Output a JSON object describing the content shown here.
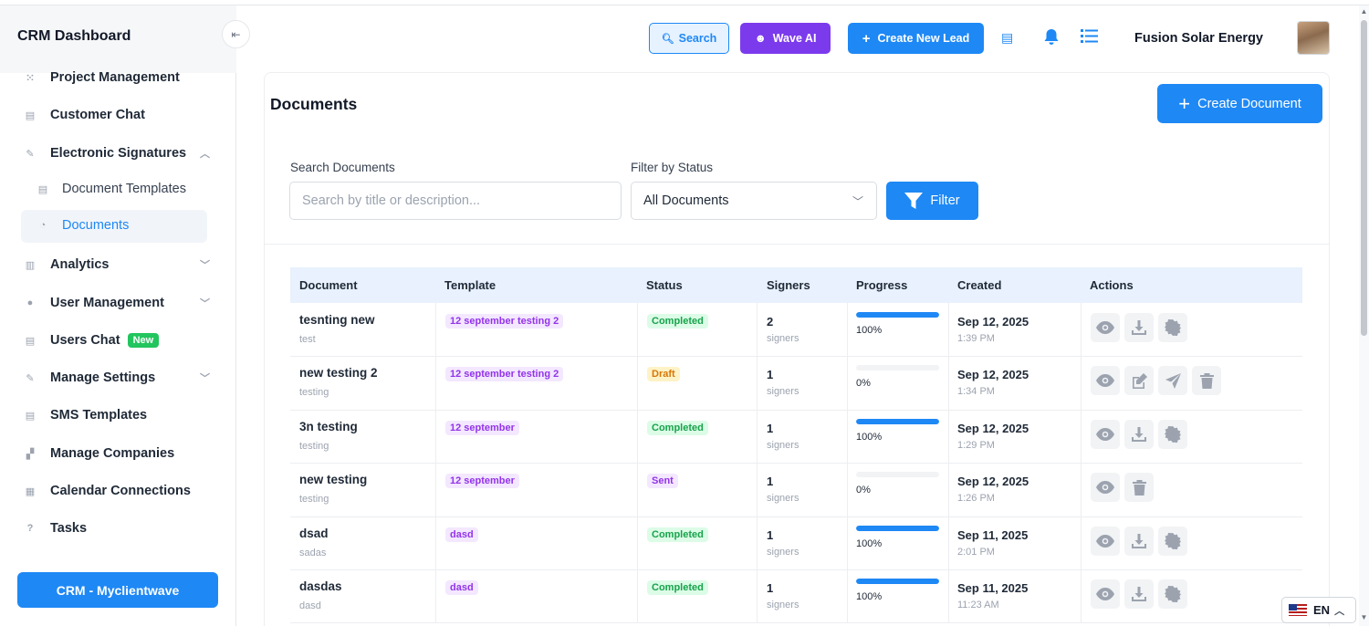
{
  "sidebar": {
    "brand": "CRM Dashboard",
    "collapse_icon": "collapse-left-icon",
    "items": [
      {
        "label": "Project Management",
        "icon": "grid-icon"
      },
      {
        "label": "Customer Chat",
        "icon": "chat-icon"
      },
      {
        "label": "Electronic Signatures",
        "icon": "pen-icon",
        "expanded": true
      },
      {
        "label": "Analytics",
        "icon": "chart-icon"
      },
      {
        "label": "User Management",
        "icon": "user-icon"
      },
      {
        "label": "Users Chat",
        "icon": "chat-icon",
        "badge": "New"
      },
      {
        "label": "Manage Settings",
        "icon": "wrench-icon"
      },
      {
        "label": "SMS Templates",
        "icon": "message-icon"
      },
      {
        "label": "Manage Companies",
        "icon": "building-icon"
      },
      {
        "label": "Calendar Connections",
        "icon": "calendar-icon"
      },
      {
        "label": "Tasks",
        "icon": "question-icon"
      }
    ],
    "sub_items": [
      {
        "label": "Document Templates",
        "icon": "template-icon"
      },
      {
        "label": "Documents",
        "icon": "document-icon",
        "active": true
      }
    ],
    "footer_button": "CRM - Myclientwave"
  },
  "header": {
    "search_label": "Search",
    "wave_label": "Wave AI",
    "create_lead_label": "Create New Lead",
    "company": "Fusion Solar Energy"
  },
  "page": {
    "title": "Documents",
    "create_button": "Create Document",
    "search_label": "Search Documents",
    "search_placeholder": "Search by title or description...",
    "filter_label": "Filter by Status",
    "filter_value": "All Documents",
    "filter_button": "Filter"
  },
  "table": {
    "columns": [
      "Document",
      "Template",
      "Status",
      "Signers",
      "Progress",
      "Created",
      "Actions"
    ],
    "rows": [
      {
        "name": "tesnting new",
        "desc": "test",
        "template": "12 september testing 2",
        "status": "Completed",
        "signers": "2",
        "signers_label": "signers",
        "progress": 100,
        "progress_text": "100%",
        "date": "Sep 12, 2025",
        "time": "1:39 PM",
        "actions": [
          "eye-icon",
          "download-icon",
          "certificate-icon"
        ]
      },
      {
        "name": "new testing 2",
        "desc": "testing",
        "template": "12 september testing 2",
        "status": "Draft",
        "signers": "1",
        "signers_label": "signers",
        "progress": 0,
        "progress_text": "0%",
        "date": "Sep 12, 2025",
        "time": "1:34 PM",
        "actions": [
          "eye-icon",
          "edit-icon",
          "send-icon",
          "trash-icon"
        ]
      },
      {
        "name": "3n testing",
        "desc": "testing",
        "template": "12 september",
        "status": "Completed",
        "signers": "1",
        "signers_label": "signers",
        "progress": 100,
        "progress_text": "100%",
        "date": "Sep 12, 2025",
        "time": "1:29 PM",
        "actions": [
          "eye-icon",
          "download-icon",
          "certificate-icon"
        ]
      },
      {
        "name": "new testing",
        "desc": "testing",
        "template": "12 september",
        "status": "Sent",
        "signers": "1",
        "signers_label": "signers",
        "progress": 0,
        "progress_text": "0%",
        "date": "Sep 12, 2025",
        "time": "1:26 PM",
        "actions": [
          "eye-icon",
          "trash-icon"
        ]
      },
      {
        "name": "dsad",
        "desc": "sadas",
        "template": "dasd",
        "status": "Completed",
        "signers": "1",
        "signers_label": "signers",
        "progress": 100,
        "progress_text": "100%",
        "date": "Sep 11, 2025",
        "time": "2:01 PM",
        "actions": [
          "eye-icon",
          "download-icon",
          "certificate-icon"
        ]
      },
      {
        "name": "dasdas",
        "desc": "dasd",
        "template": "dasd",
        "status": "Completed",
        "signers": "1",
        "signers_label": "signers",
        "progress": 100,
        "progress_text": "100%",
        "date": "Sep 11, 2025",
        "time": "11:23 AM",
        "actions": [
          "eye-icon",
          "download-icon",
          "certificate-icon"
        ]
      }
    ]
  },
  "language": {
    "code": "EN"
  },
  "colors": {
    "accent": "#1e88f5",
    "wave": "#7c3aed",
    "completed": "#16a34a",
    "draft": "#d97706",
    "sent": "#9333ea"
  }
}
